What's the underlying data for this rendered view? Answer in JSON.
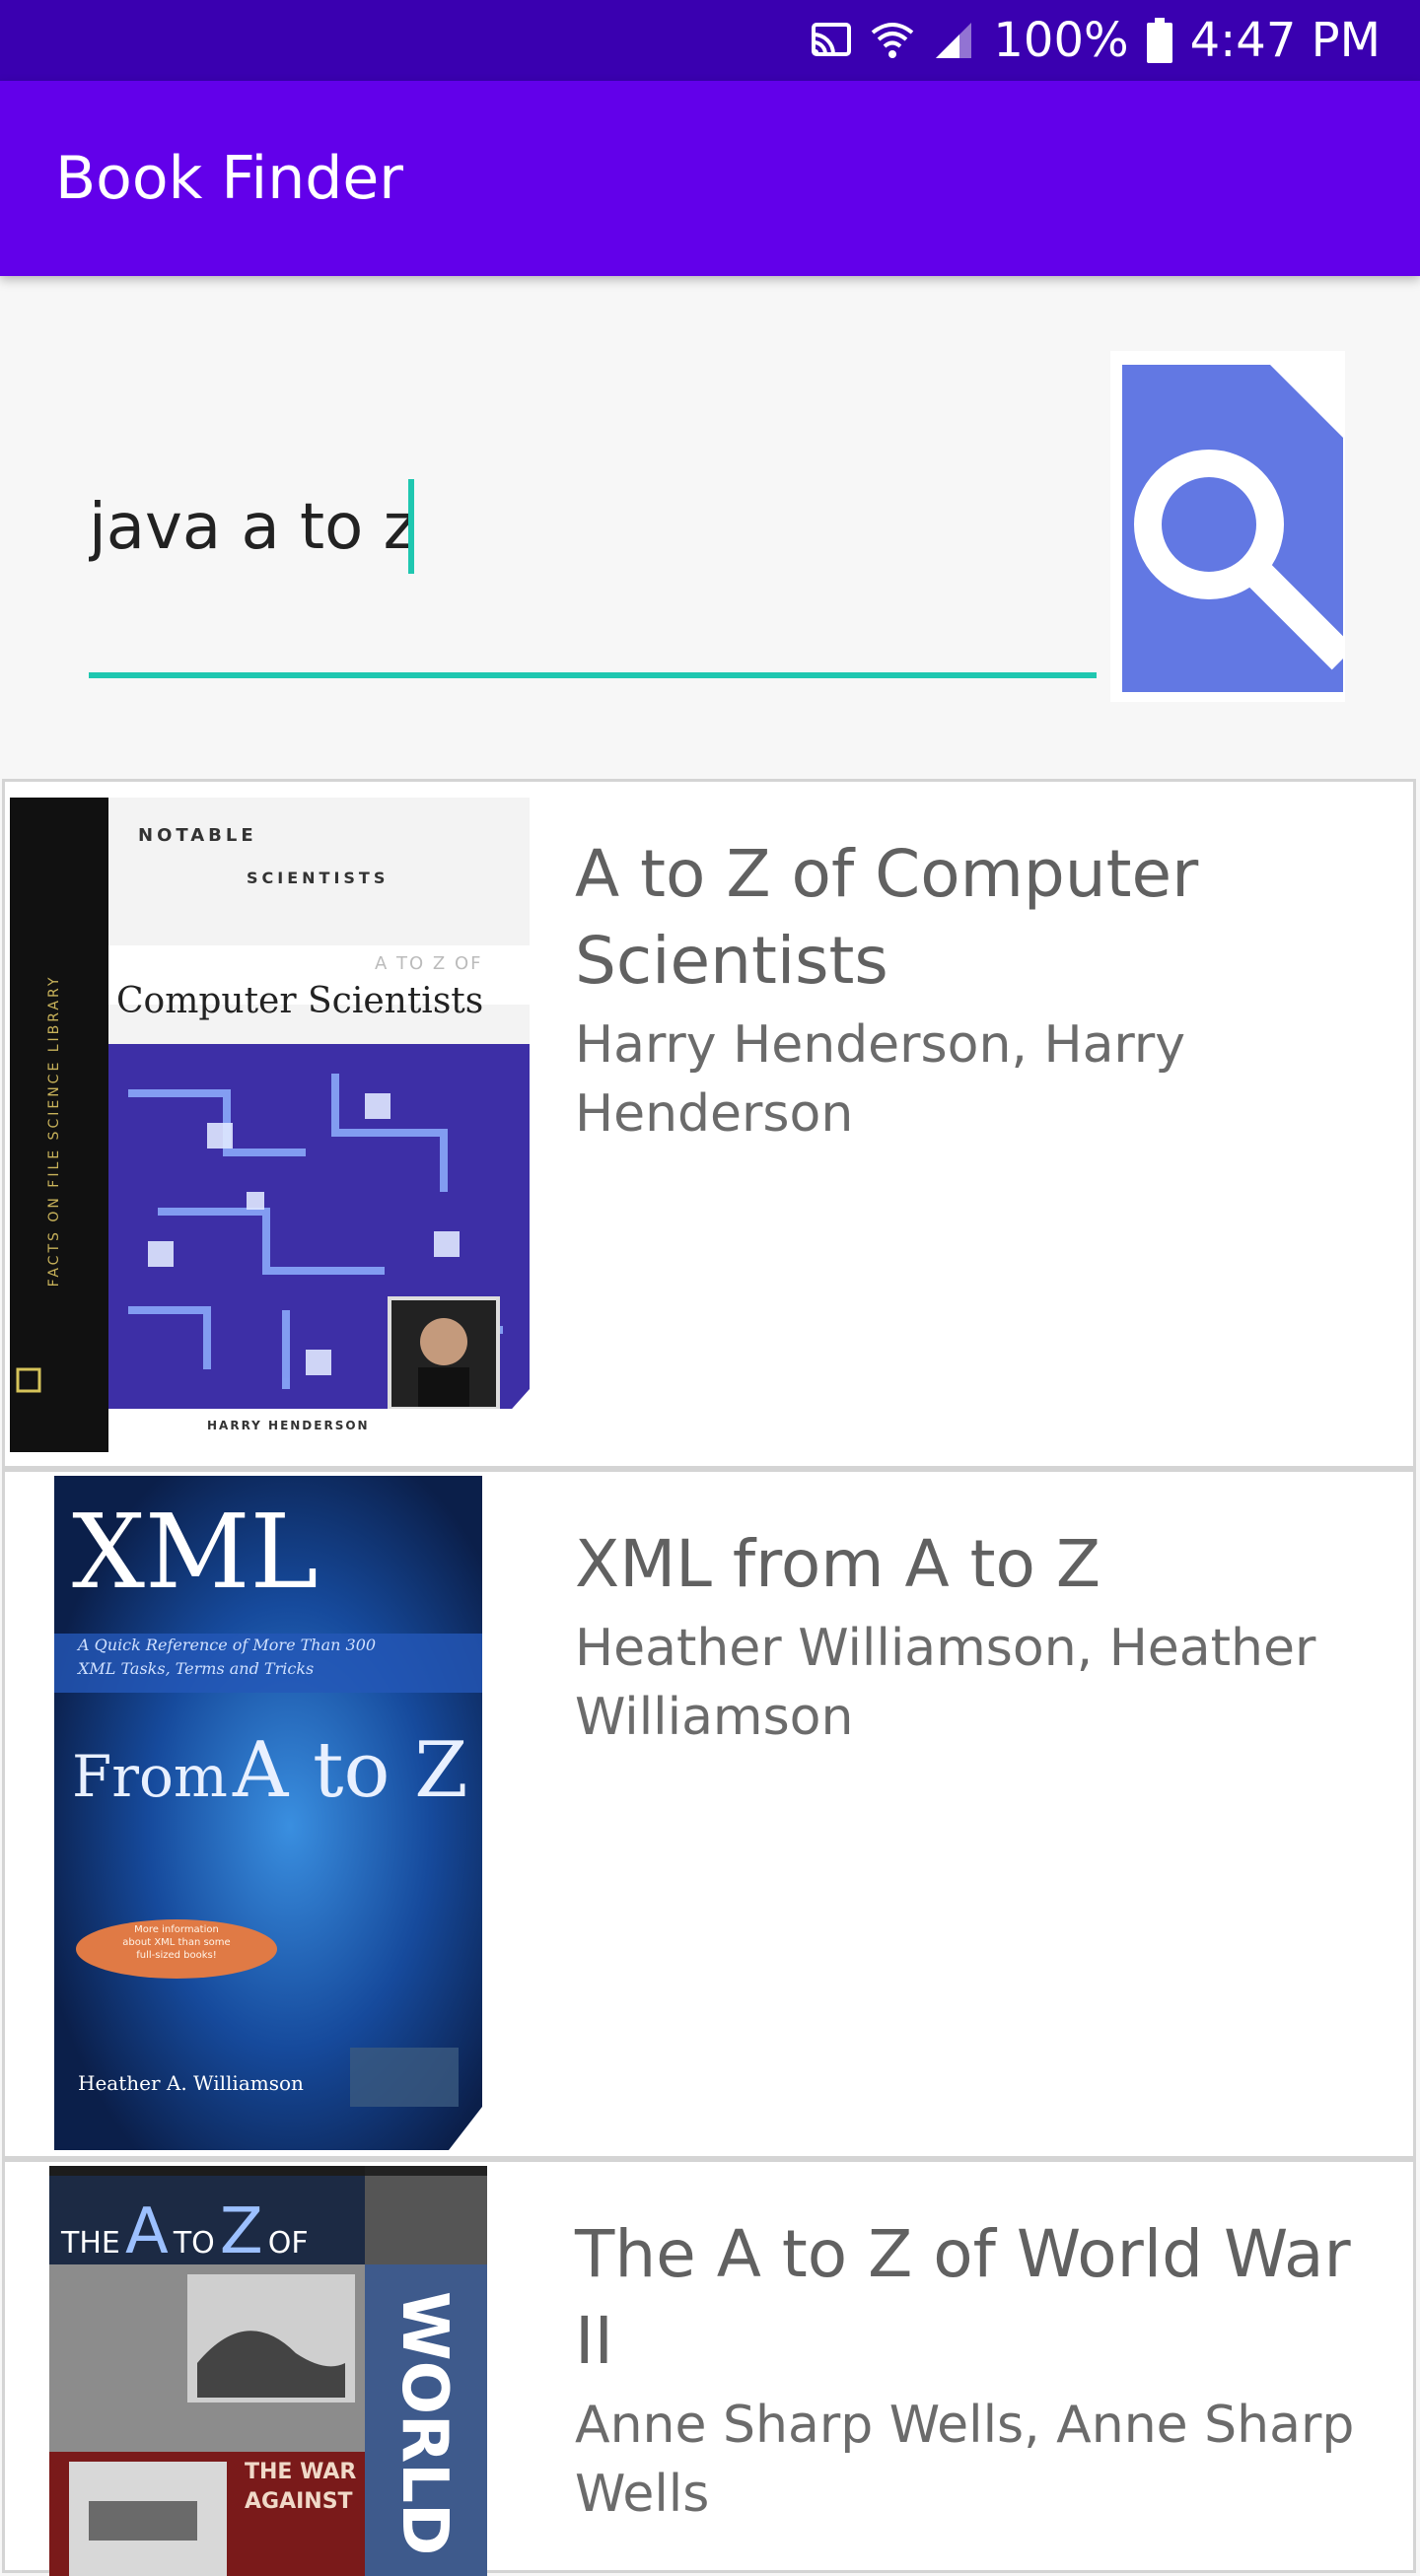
{
  "status_bar": {
    "battery_percent": "100%",
    "time": "4:47 PM",
    "icons": [
      "cast-icon",
      "wifi-icon",
      "signal-icon",
      "battery-icon"
    ]
  },
  "app_bar": {
    "title": "Book Finder",
    "color": "#6200ea"
  },
  "search": {
    "value": "java a to z",
    "accent_color": "#1fc7b0",
    "button_icon": "search-document-icon",
    "button_color": "#6278e3"
  },
  "results": [
    {
      "title": "A to Z of Computer Scientists",
      "authors": "Harry Henderson, Harry Henderson",
      "cover": {
        "series_top": "NOTABLE",
        "series_bottom": "SCIENTISTS",
        "subtitle": "A TO Z OF",
        "title": "Computer Scientists",
        "spine": "FACTS ON FILE SCIENCE LIBRARY",
        "author": "HARRY HENDERSON"
      }
    },
    {
      "title": "XML from A to Z",
      "authors": "Heather Williamson, Heather Williamson",
      "cover": {
        "heading": "XML",
        "tagline_1": "A Quick Reference of More Than 300",
        "tagline_2": "XML Tasks, Terms and Tricks",
        "main_from": "From",
        "main_a_to_z": "A to Z",
        "badge_1": "More information",
        "badge_2": "about XML than some",
        "badge_3": "full-sized books!",
        "author": "Heather A. Williamson"
      }
    },
    {
      "title": "The A to Z of World War II",
      "authors": "Anne Sharp Wells, Anne Sharp Wells",
      "cover": {
        "the": "THE",
        "a": "A",
        "to": "TO",
        "z": "Z",
        "of": "OF",
        "spine": "WORLD",
        "banner_1": "THE WAR",
        "banner_2": "AGAINST"
      }
    }
  ]
}
